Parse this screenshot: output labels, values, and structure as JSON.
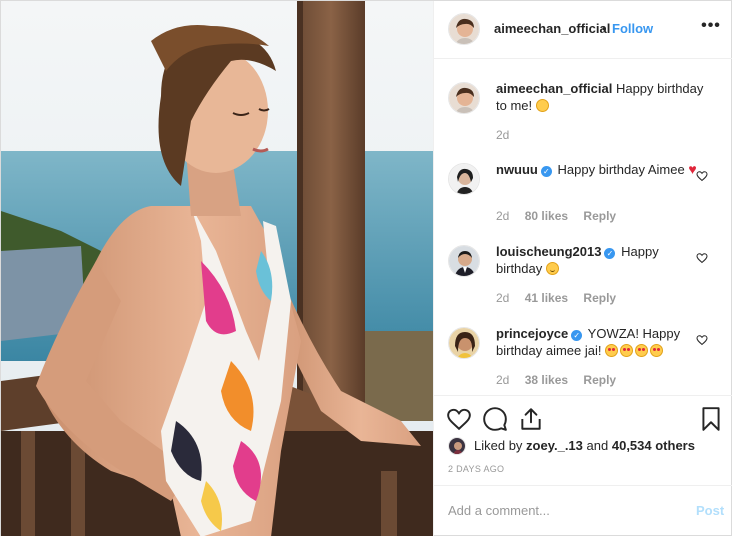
{
  "header": {
    "username": "aimeechan_official",
    "separator": "•",
    "follow_label": "Follow",
    "more_icon": "more-horizontal-icon",
    "more_glyph": "•••"
  },
  "caption": {
    "username": "aimeechan_official",
    "text": "Happy birthday to me!",
    "emoji": "kissing-face-emoji",
    "age": "2d"
  },
  "comments": [
    {
      "username": "nwuuu",
      "verified": true,
      "text": "Happy birthday Aimee",
      "emoji": "red-heart",
      "heart": "♥",
      "age": "2d",
      "likes": "80 likes",
      "reply": "Reply"
    },
    {
      "username": "louischeung2013",
      "verified": true,
      "text": "Happy birthday",
      "emoji": "smiling-face",
      "age": "2d",
      "likes": "41 likes",
      "reply": "Reply"
    },
    {
      "username": "princejoyce",
      "verified": true,
      "text": "YOWZA! Happy birthday aimee jai!",
      "emoji": "heart-eyes x4",
      "age": "2d",
      "likes": "38 likes",
      "reply": "Reply"
    }
  ],
  "verified_glyph": "✓",
  "actions": {
    "like_icon": "heart-outline-icon",
    "comment_icon": "comment-bubble-icon",
    "share_icon": "share-upload-icon",
    "save_icon": "bookmark-icon"
  },
  "likes": {
    "prefix": "Liked by",
    "user": "zoey._.13",
    "middle": "and",
    "count": "40,534 others"
  },
  "timestamp": "2 DAYS AGO",
  "add_comment": {
    "placeholder": "Add a comment...",
    "post_label": "Post"
  },
  "colors": {
    "accent": "#3897f0",
    "post_disabled": "#b2dffc",
    "meta": "#999999",
    "text": "#262626",
    "heart": "#e0263a"
  }
}
